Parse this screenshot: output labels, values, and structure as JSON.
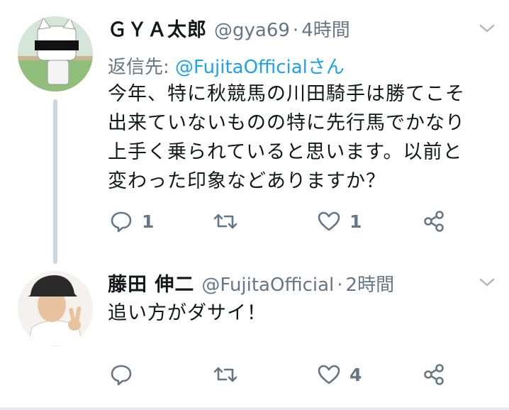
{
  "tweet1": {
    "name": "ＧＹＡ太郎",
    "handle": "@gya69",
    "separator": "·",
    "time": "4時間",
    "reply_label": "返信先:",
    "reply_mention": "@FujitaOfficialさん",
    "body": "今年、特に秋競馬の川田騎手は勝てこそ\n出来ていないものの特に先行馬でかなり\n上手く乗られていると思います。以前と\n変わった印象などありますか？",
    "reply_count": "1",
    "retweet_count": "",
    "like_count": "1"
  },
  "tweet2": {
    "name": "藤田 伸二",
    "handle": "@FujitaOfficial",
    "separator": "·",
    "time": "2時間",
    "body": "追い方がダサイ！",
    "reply_count": "",
    "retweet_count": "",
    "like_count": "4"
  },
  "colors": {
    "text": "#14171a",
    "secondary": "#657786",
    "link": "#1da1f2",
    "thread_line": "#ccd6dd"
  },
  "icons": [
    "reply-icon",
    "retweet-icon",
    "like-icon",
    "share-icon",
    "chevron-down-icon"
  ]
}
